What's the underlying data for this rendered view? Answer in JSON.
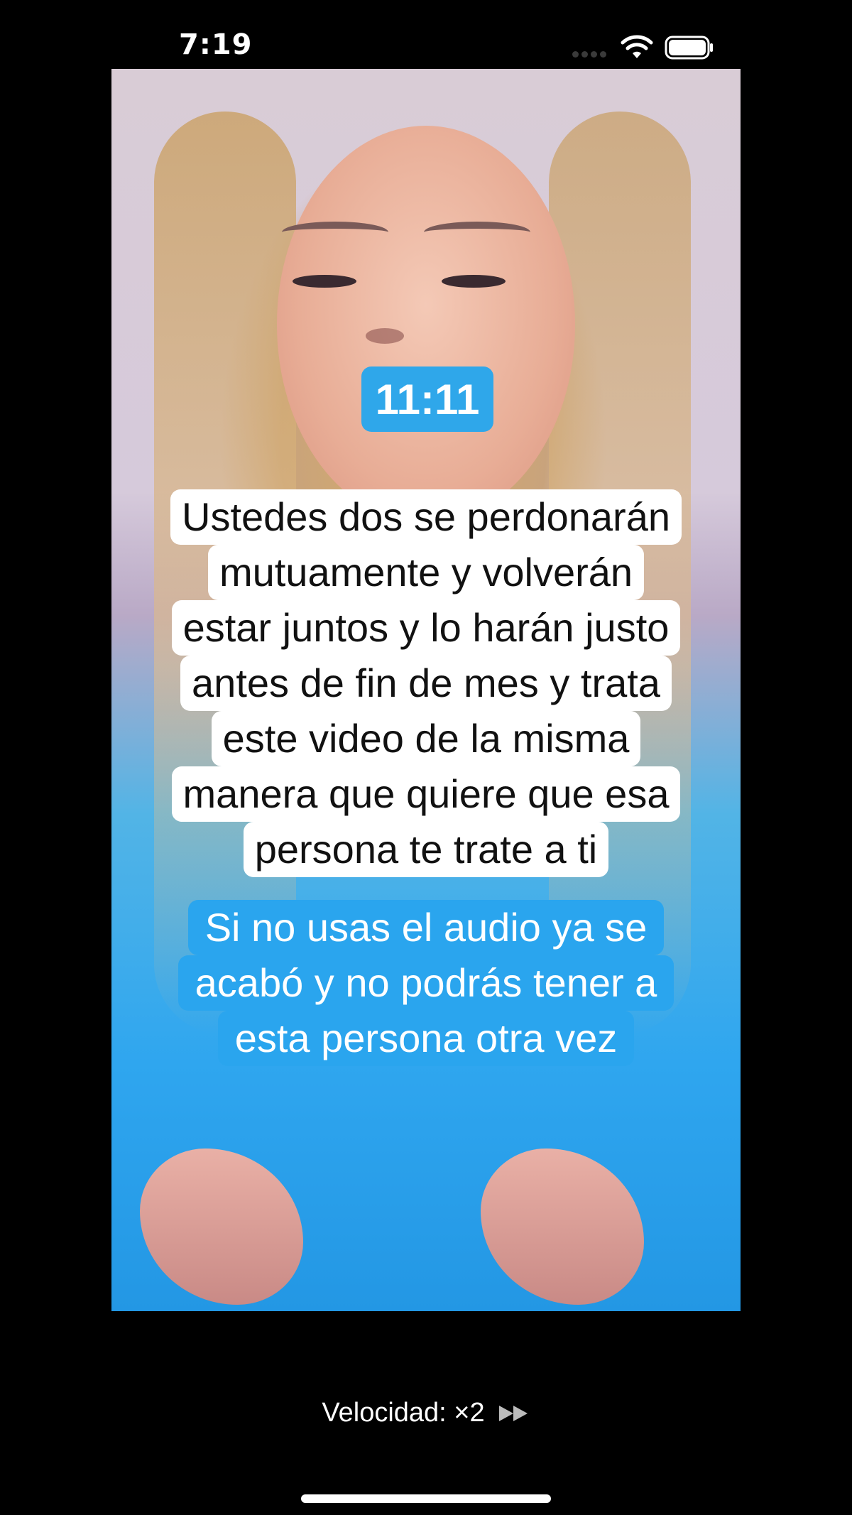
{
  "status_bar": {
    "time": "7:19"
  },
  "video": {
    "time_tag": "11:11",
    "white_caption_lines": [
      "Ustedes dos se perdonarán",
      "mutuamente y volverán",
      "estar juntos y lo harán justo",
      "antes de fin de mes y trata",
      "este video de la misma",
      "manera que quiere que esa",
      "persona te trate a ti"
    ],
    "blue_caption_lines": [
      "Si no usas el audio ya se",
      "acabó y no podrás tener a",
      "esta persona otra vez"
    ]
  },
  "playback": {
    "speed_label": "Velocidad: ×2",
    "icon": "fast-forward-icon"
  },
  "colors": {
    "caption_blue": "#2aa5ee",
    "background": "#000000"
  }
}
